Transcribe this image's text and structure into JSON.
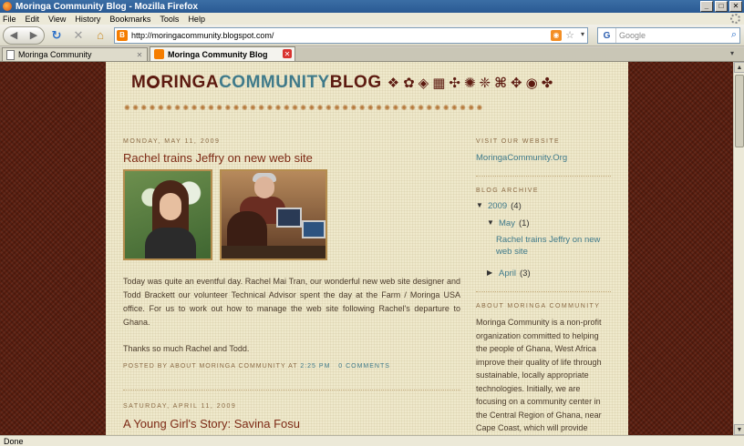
{
  "window": {
    "title": "Moringa Community Blog - Mozilla Firefox"
  },
  "menu": [
    "File",
    "Edit",
    "View",
    "History",
    "Bookmarks",
    "Tools",
    "Help"
  ],
  "nav": {
    "url": "http://moringacommunity.blogspot.com/",
    "search_placeholder": "Google",
    "search_engine_icon": "G"
  },
  "tabs": [
    {
      "label": "Moringa Community",
      "active": false
    },
    {
      "label": "Moringa Community Blog",
      "active": true
    }
  ],
  "blog": {
    "logo_part1": "MORINGA",
    "logo_part2": "COMMUNITY",
    "logo_part3": "BLOG",
    "logo_o": "O",
    "adinkra_glyphs": [
      "❖",
      "✿",
      "◈",
      "▦",
      "✣",
      "✺",
      "❈",
      "⌘",
      "✥",
      "◉",
      "✤"
    ]
  },
  "post1": {
    "date": "Monday, May 11, 2009",
    "title": "Rachel trains Jeffry on new web site",
    "body1": "Today was quite an eventful day.  Rachel Mai Tran, our wonderful new web site designer and Todd Brackett our volunteer Technical Advisor spent the day at the Farm / Moringa USA office. For us to work out how to manage the web site following Rachel's departure to Ghana.",
    "body2": "Thanks so much Rachel and Todd.",
    "posted_by_label": "Posted by",
    "author": "About Moringa Community",
    "at_label": "at",
    "time": "2:25 PM",
    "comments": "0 comments"
  },
  "post2": {
    "date": "Saturday, April 11, 2009",
    "title": "A Young Girl's Story: Savina Fosu"
  },
  "sidebar": {
    "visit_heading": "Visit our website",
    "website_link": "MoringaCommunity.Org",
    "archive_heading": "Blog Archive",
    "archive": {
      "year": "2009",
      "year_count": "(4)",
      "month": "May",
      "month_count": "(1)",
      "post": "Rachel trains Jeffry on new web site",
      "month2": "April",
      "month2_count": "(3)"
    },
    "about_heading": "About Moringa Community",
    "about_text": "Moringa Community is a non-profit organization committed to helping the people of Ghana, West Africa improve their quality of life through sustainable, locally appropriate technologies. Initially, we are focusing on a community center in the Central Region of Ghana, near Cape Coast, which will provide"
  },
  "status": "Done"
}
